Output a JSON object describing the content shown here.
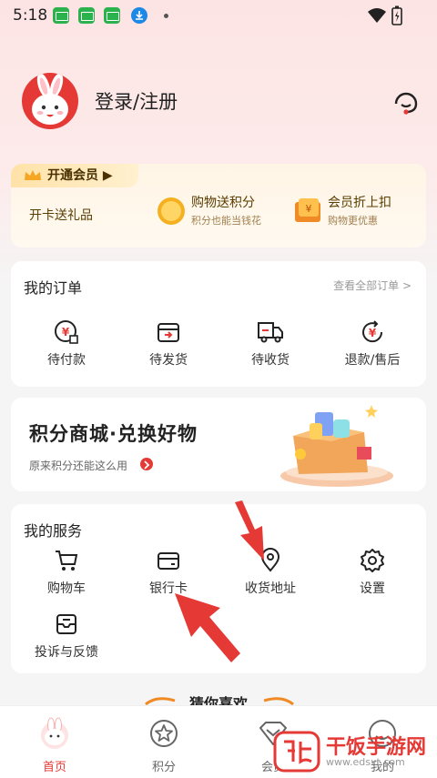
{
  "status_bar": {
    "time": "5:18"
  },
  "header": {
    "login_label": "登录/注册"
  },
  "vip": {
    "tag_label": "开通会员 ▶",
    "gift_text": "开卡送礼品",
    "benefits": [
      {
        "title": "购物送积分",
        "subtitle": "积分也能当钱花",
        "icon": "coin-icon"
      },
      {
        "title": "会员折上扣",
        "subtitle": "购物更优惠",
        "icon": "coupon-icon"
      }
    ]
  },
  "orders": {
    "title": "我的订单",
    "view_all": "查看全部订单 >",
    "items": [
      {
        "label": "待付款",
        "icon": "pending-payment-icon"
      },
      {
        "label": "待发货",
        "icon": "pending-shipment-icon"
      },
      {
        "label": "待收货",
        "icon": "delivery-truck-icon"
      },
      {
        "label": "退款/售后",
        "icon": "refund-icon"
      }
    ]
  },
  "points_mall": {
    "title": "积分商城·兑换好物",
    "subtitle": "原来积分还能这么用"
  },
  "services": {
    "title": "我的服务",
    "items": [
      {
        "label": "购物车",
        "icon": "cart-icon"
      },
      {
        "label": "银行卡",
        "icon": "bank-card-icon"
      },
      {
        "label": "收货地址",
        "icon": "location-pin-icon"
      },
      {
        "label": "设置",
        "icon": "gear-icon"
      },
      {
        "label": "投诉与反馈",
        "icon": "feedback-icon"
      }
    ]
  },
  "guess_you_like": "猜你喜欢",
  "tabbar": {
    "tabs": [
      {
        "label": "首页",
        "icon": "home-icon"
      },
      {
        "label": "积分",
        "icon": "star-icon"
      },
      {
        "label": "会员",
        "icon": "member-icon"
      },
      {
        "label": "我的",
        "icon": "profile-icon"
      }
    ]
  },
  "watermark": {
    "name": "干饭手游网",
    "url": "www.edsxt.com"
  },
  "colors": {
    "accent": "#e53935",
    "vip_gold": "#f5a623",
    "background": "#f5f5f5"
  }
}
